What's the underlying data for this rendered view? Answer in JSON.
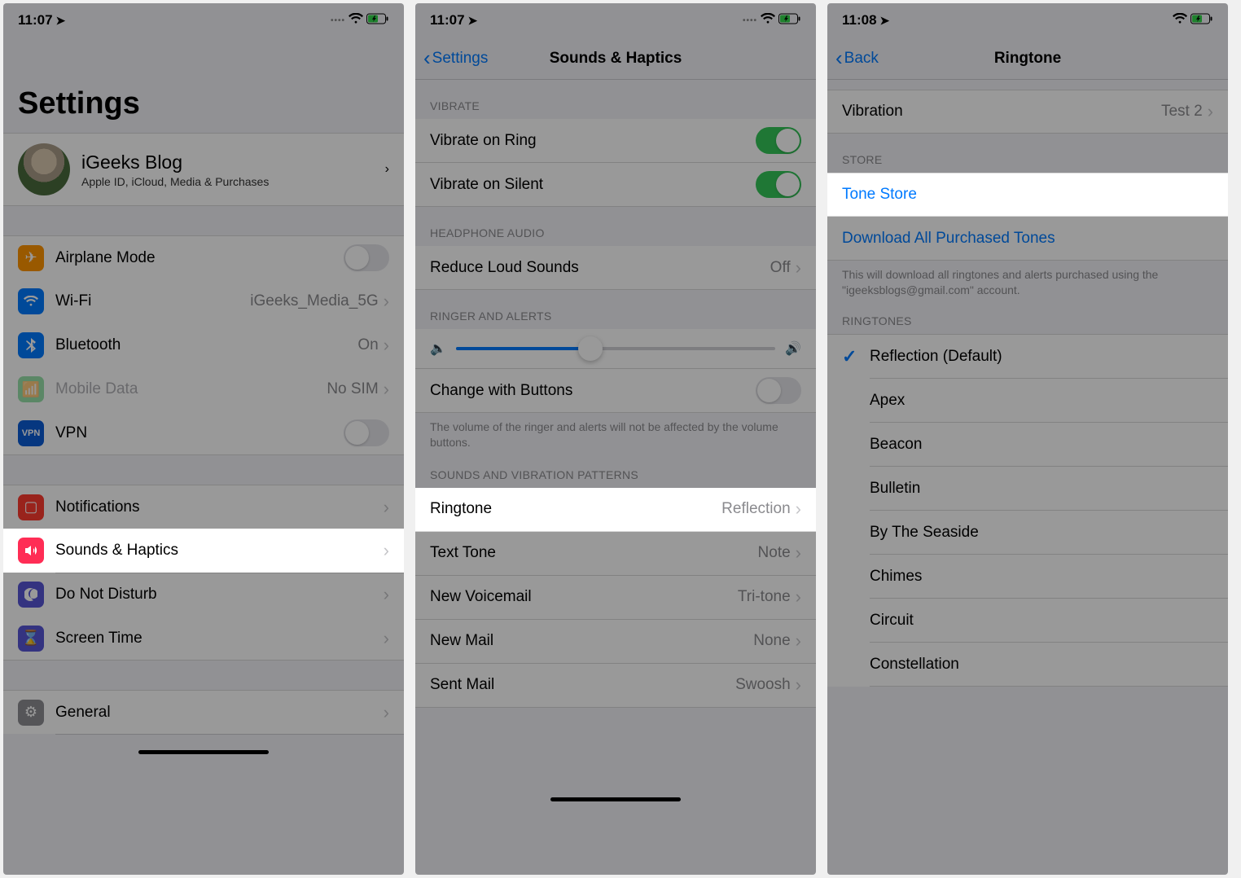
{
  "status": {
    "time1": "11:07",
    "time2": "11:07",
    "time3": "11:08"
  },
  "screen1": {
    "title": "Settings",
    "profile": {
      "name": "iGeeks Blog",
      "sub": "Apple ID, iCloud, Media & Purchases"
    },
    "airplane": "Airplane Mode",
    "wifi": {
      "label": "Wi-Fi",
      "value": "iGeeks_Media_5G"
    },
    "bluetooth": {
      "label": "Bluetooth",
      "value": "On"
    },
    "mobiledata": {
      "label": "Mobile Data",
      "value": "No SIM"
    },
    "vpn": "VPN",
    "notifications": "Notifications",
    "sounds": "Sounds & Haptics",
    "dnd": "Do Not Disturb",
    "screentime": "Screen Time",
    "general": "General"
  },
  "screen2": {
    "back": "Settings",
    "title": "Sounds & Haptics",
    "sec_vibrate": "Vibrate",
    "vibrate_ring": "Vibrate on Ring",
    "vibrate_silent": "Vibrate on Silent",
    "sec_headphone": "Headphone Audio",
    "reduce_loud": {
      "label": "Reduce Loud Sounds",
      "value": "Off"
    },
    "sec_ringer": "Ringer and Alerts",
    "change_buttons": "Change with Buttons",
    "footer_change": "The volume of the ringer and alerts will not be affected by the volume buttons.",
    "sec_patterns": "Sounds and Vibration Patterns",
    "ringtone": {
      "label": "Ringtone",
      "value": "Reflection"
    },
    "text_tone": {
      "label": "Text Tone",
      "value": "Note"
    },
    "voicemail": {
      "label": "New Voicemail",
      "value": "Tri-tone"
    },
    "newmail": {
      "label": "New Mail",
      "value": "None"
    },
    "sentmail": {
      "label": "Sent Mail",
      "value": "Swoosh"
    }
  },
  "screen3": {
    "back": "Back",
    "title": "Ringtone",
    "vibration": {
      "label": "Vibration",
      "value": "Test 2"
    },
    "sec_store": "Store",
    "tone_store": "Tone Store",
    "download_all": "Download All Purchased Tones",
    "footer_download": "This will download all ringtones and alerts purchased using the \"igeeksblogs@gmail.com\" account.",
    "sec_ringtones": "Ringtones",
    "tones": [
      "Reflection (Default)",
      "Apex",
      "Beacon",
      "Bulletin",
      "By The Seaside",
      "Chimes",
      "Circuit",
      "Constellation"
    ],
    "selected_index": 0
  }
}
